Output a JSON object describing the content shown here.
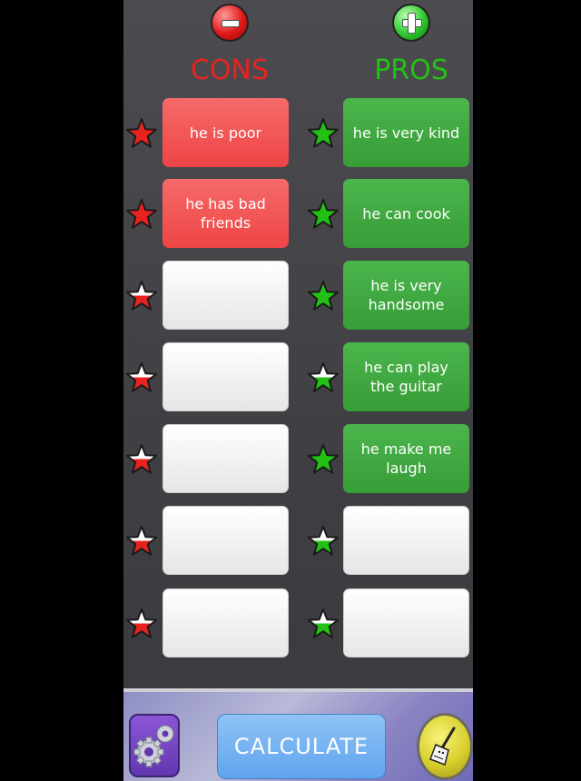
{
  "header": {
    "cons_title": "CONS",
    "pros_title": "PROS"
  },
  "colors": {
    "cons_accent": "#e8231f",
    "pros_accent": "#22c214",
    "cons_box": "#ee4545",
    "pros_box": "#3aa33a",
    "empty_box": "#ffffff",
    "calculate_button": "#6cabf0",
    "settings_button": "#7446c4",
    "clean_button": "#d8cf2c"
  },
  "cons": [
    {
      "text": "he is poor",
      "star_fill": 1.0
    },
    {
      "text": "he has bad friends",
      "star_fill": 1.0
    },
    {
      "text": "",
      "star_fill": 0.5
    },
    {
      "text": "",
      "star_fill": 0.5
    },
    {
      "text": "",
      "star_fill": 0.5
    },
    {
      "text": "",
      "star_fill": 0.5
    },
    {
      "text": "",
      "star_fill": 0.5
    }
  ],
  "pros": [
    {
      "text": "he is very kind",
      "star_fill": 1.0
    },
    {
      "text": "he can cook",
      "star_fill": 1.0
    },
    {
      "text": "he is very handsome",
      "star_fill": 1.0
    },
    {
      "text": "he can play the guitar",
      "star_fill": 0.5
    },
    {
      "text": "he make me laugh",
      "star_fill": 1.0
    },
    {
      "text": "",
      "star_fill": 0.5
    },
    {
      "text": "",
      "star_fill": 0.5
    }
  ],
  "footer": {
    "calculate_label": "CALCULATE",
    "settings_icon": "gears-icon",
    "clean_icon": "broom-icon"
  }
}
